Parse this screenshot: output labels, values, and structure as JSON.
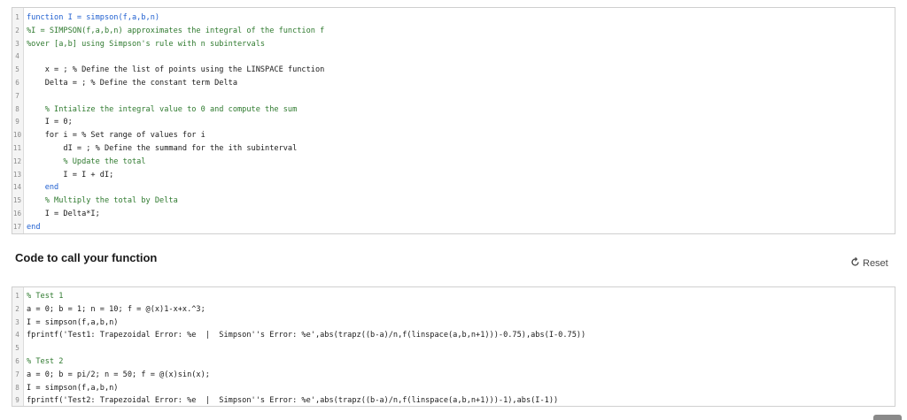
{
  "function_editor": {
    "lines": [
      {
        "n": "1",
        "t": "function I = simpson(f,a,b,n)",
        "k": "kw"
      },
      {
        "n": "2",
        "t": "%I = SIMPSON(f,a,b,n) approximates the integral of the function f",
        "k": "cm"
      },
      {
        "n": "3",
        "t": "%over [a,b] using Simpson's rule with n subintervals",
        "k": "cm"
      },
      {
        "n": "4",
        "t": "",
        "k": ""
      },
      {
        "n": "5",
        "t": "    x = ; % Define the list of points using the LINSPACE function",
        "k": ""
      },
      {
        "n": "6",
        "t": "    Delta = ; % Define the constant term Delta",
        "k": ""
      },
      {
        "n": "7",
        "t": "",
        "k": ""
      },
      {
        "n": "8",
        "t": "    % Intialize the integral value to 0 and compute the sum",
        "k": "cm"
      },
      {
        "n": "9",
        "t": "    I = 0;",
        "k": ""
      },
      {
        "n": "10",
        "t": "    for i = % Set range of values for i",
        "k": ""
      },
      {
        "n": "11",
        "t": "        dI = ; % Define the summand for the ith subinterval",
        "k": ""
      },
      {
        "n": "12",
        "t": "        % Update the total",
        "k": "cm"
      },
      {
        "n": "13",
        "t": "        I = I + dI;",
        "k": ""
      },
      {
        "n": "14",
        "t": "    end",
        "k": "kw"
      },
      {
        "n": "15",
        "t": "    % Multiply the total by Delta",
        "k": "cm"
      },
      {
        "n": "16",
        "t": "    I = Delta*I;",
        "k": ""
      },
      {
        "n": "17",
        "t": "end",
        "k": "kw"
      }
    ]
  },
  "call_section": {
    "title": "Code to call your function",
    "reset_label": "Reset",
    "reset_icon": "reset-icon"
  },
  "call_editor": {
    "lines": [
      {
        "n": "1",
        "t": "% Test 1",
        "k": "cm"
      },
      {
        "n": "2",
        "t": "a = 0; b = 1; n = 10; f = @(x)1-x+x.^3;",
        "k": ""
      },
      {
        "n": "3",
        "t": "I = simpson(f,a,b,n)",
        "k": ""
      },
      {
        "n": "4",
        "t": "fprintf('Test1: Trapezoidal Error: %e  |  Simpson''s Error: %e',abs(trapz((b-a)/n,f(linspace(a,b,n+1)))-0.75),abs(I-0.75))",
        "k": ""
      },
      {
        "n": "5",
        "t": "",
        "k": ""
      },
      {
        "n": "6",
        "t": "% Test 2",
        "k": "cm"
      },
      {
        "n": "7",
        "t": "a = 0; b = pi/2; n = 50; f = @(x)sin(x);",
        "k": ""
      },
      {
        "n": "8",
        "t": "I = simpson(f,a,b,n)",
        "k": ""
      },
      {
        "n": "9",
        "t": "fprintf('Test2: Trapezoidal Error: %e  |  Simpson''s Error: %e',abs(trapz((b-a)/n,f(linspace(a,b,n+1)))-1),abs(I-1))",
        "k": ""
      }
    ]
  },
  "colors": {
    "keyword": "#1f5fd0",
    "comment": "#2f7a2f",
    "string": "#a020f0"
  }
}
